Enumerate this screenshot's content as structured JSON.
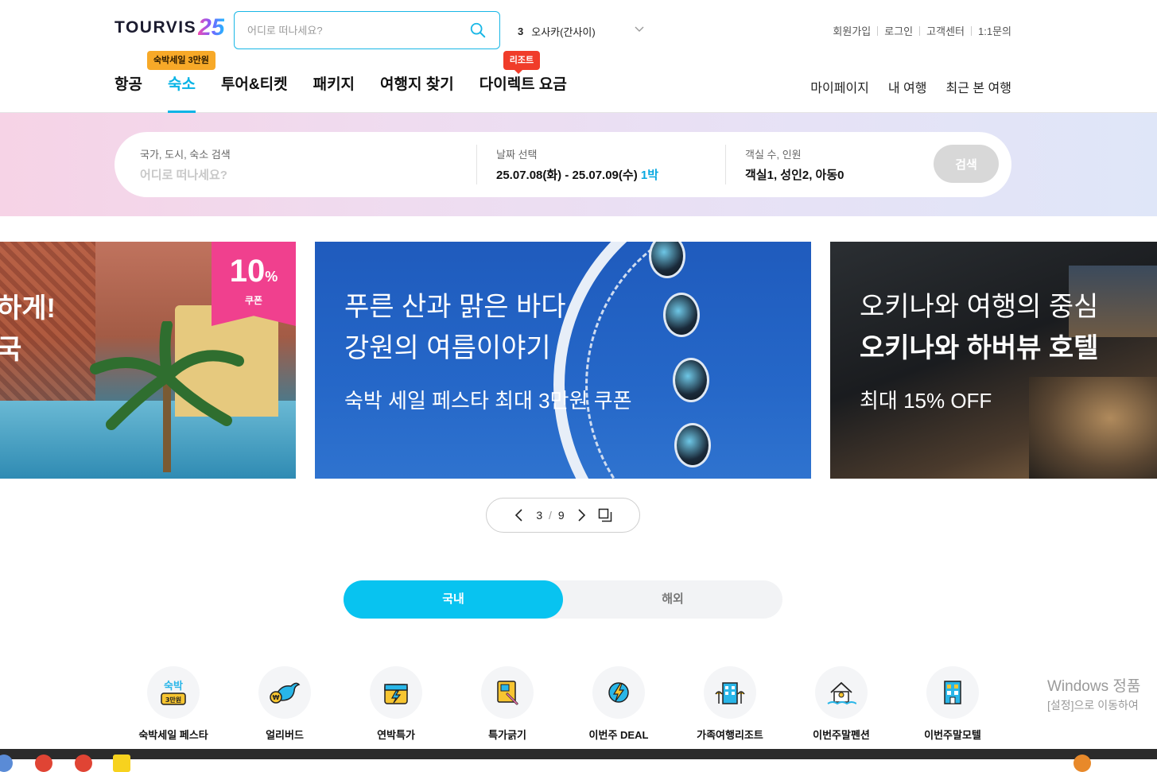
{
  "brand": {
    "logo_text": "TOURVIS",
    "logo_num": "25"
  },
  "header": {
    "search_placeholder": "어디로 떠나세요?",
    "trending": {
      "rank": "3",
      "keyword": "오사카(간사이)"
    },
    "util_links": [
      "회원가입",
      "로그인",
      "고객센터",
      "1:1문의"
    ],
    "nav": [
      {
        "label": "항공"
      },
      {
        "label": "숙소",
        "badge": "숙박세일 3만원"
      },
      {
        "label": "투어&티켓"
      },
      {
        "label": "패키지"
      },
      {
        "label": "여행지 찾기"
      },
      {
        "label": "다이렉트 요금",
        "badge": "리조트"
      }
    ],
    "nav_right": [
      "마이페이지",
      "내 여행",
      "최근 본 여행"
    ]
  },
  "search": {
    "destination_label": "국가, 도시, 숙소 검색",
    "destination_placeholder": "어디로 떠나세요?",
    "date_label": "날짜 선택",
    "date_value": "25.07.08(화) - 25.07.09(수)",
    "nights": "1박",
    "guests_label": "객실 수, 인원",
    "guests_value": "객실1, 성인2, 아동0",
    "button": "검색"
  },
  "banners": [
    {
      "lines": [
        "하게!",
        "국"
      ],
      "coupon_pct": "10",
      "coupon_unit": "%",
      "coupon_label": "쿠폰"
    },
    {
      "lines": [
        "푸른 산과 맑은 바다",
        "강원의 여름이야기"
      ],
      "sub": "숙박 세일 페스타 최대 3만원 쿠폰"
    },
    {
      "lines": [
        "오키나와 여행의 중심",
        "오키나와 하버뷰 호텔"
      ],
      "sub": "최대 15% OFF"
    }
  ],
  "pager": {
    "current": "3",
    "sep": "/",
    "total": "9"
  },
  "region_toggle": {
    "domestic": "국내",
    "overseas": "해외"
  },
  "categories": [
    {
      "label": "숙박세일 페스타",
      "icon": "sale-ticket-icon"
    },
    {
      "label": "얼리버드",
      "icon": "bird-icon"
    },
    {
      "label": "연박특가",
      "icon": "calendar-icon"
    },
    {
      "label": "특가긁기",
      "icon": "scratch-card-icon"
    },
    {
      "label": "이번주 DEAL",
      "icon": "lightning-icon"
    },
    {
      "label": "가족여행리조트",
      "icon": "resort-icon"
    },
    {
      "label": "이번주말펜션",
      "icon": "pension-icon"
    },
    {
      "label": "이번주말모텔",
      "icon": "motel-icon"
    }
  ],
  "watermark": {
    "line1": "Windows 정품",
    "line2": "[설정]으로 이동하여"
  },
  "colors": {
    "accent": "#08b4e6",
    "toggle_on": "#08c3f0",
    "coupon": "#f0408e",
    "badge_orange": "#f7a928",
    "badge_red": "#f03c2a"
  }
}
